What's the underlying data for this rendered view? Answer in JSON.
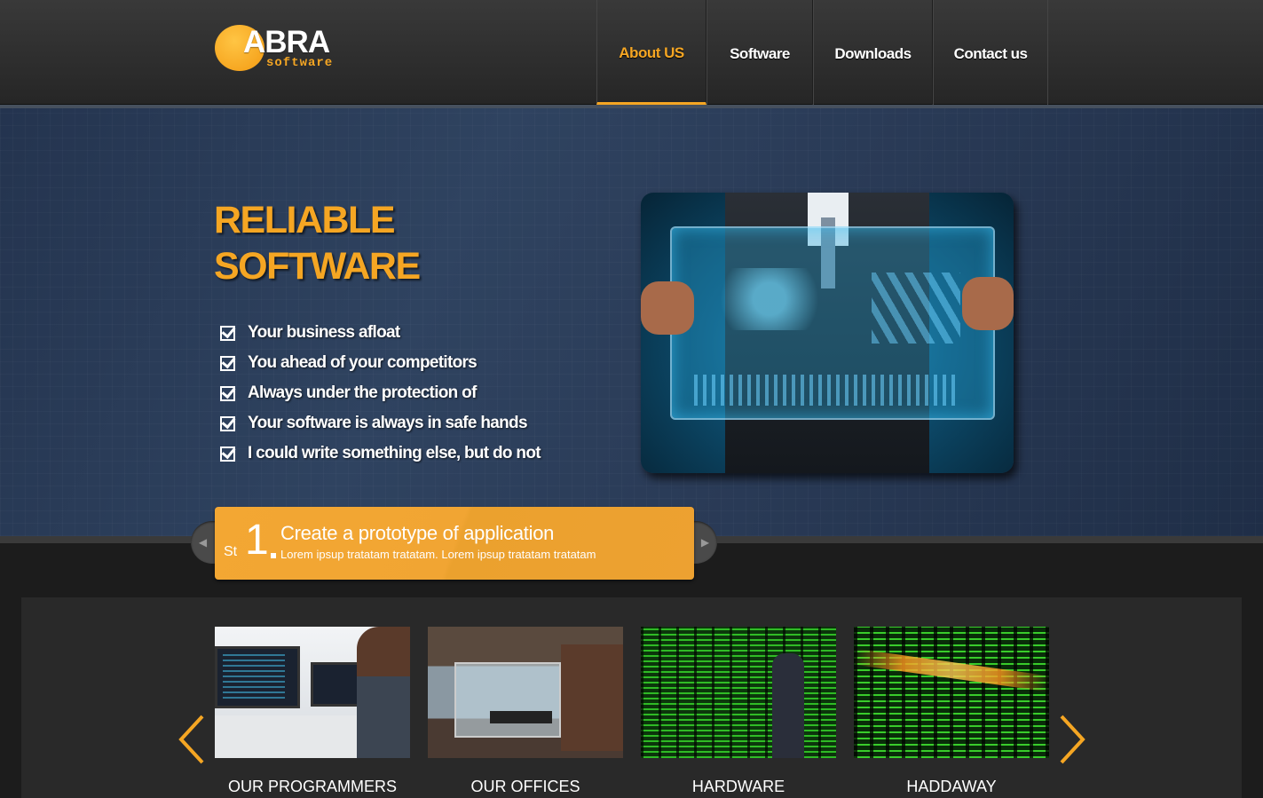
{
  "header": {
    "logo": {
      "name": "ABRA",
      "tagline": "software"
    },
    "nav": [
      {
        "label": "About US",
        "active": true
      },
      {
        "label": "Software",
        "active": false
      },
      {
        "label": "Downloads",
        "active": false
      },
      {
        "label": "Contact us",
        "active": false
      }
    ]
  },
  "hero": {
    "title_line1": "RELIABLE",
    "title_line2": "SOFTWARE",
    "features": [
      "Your business afloat",
      "You ahead of your competitors",
      "Always under the protection of",
      "Your software is always in safe hands",
      "I could write something else, but do not"
    ]
  },
  "slider": {
    "prefix": "St",
    "number": "1",
    "title": "Create a prototype of application",
    "description": "Lorem ipsup tratatam tratatam. Lorem ipsup tratatam tratatam",
    "prev_icon": "triangle-left-icon",
    "next_icon": "triangle-right-icon"
  },
  "gallery": {
    "items": [
      {
        "label": "OUR PROGRAMMERS"
      },
      {
        "label": "OUR OFFICES"
      },
      {
        "label": "HARDWARE"
      },
      {
        "label": "HADDAWAY"
      }
    ],
    "prev_icon": "chevron-left-icon",
    "next_icon": "chevron-right-icon"
  },
  "colors": {
    "accent": "#f5a623",
    "header_bg": "#2e2e2e",
    "hero_bg": "#2b3d58",
    "gallery_bg": "#292929"
  }
}
